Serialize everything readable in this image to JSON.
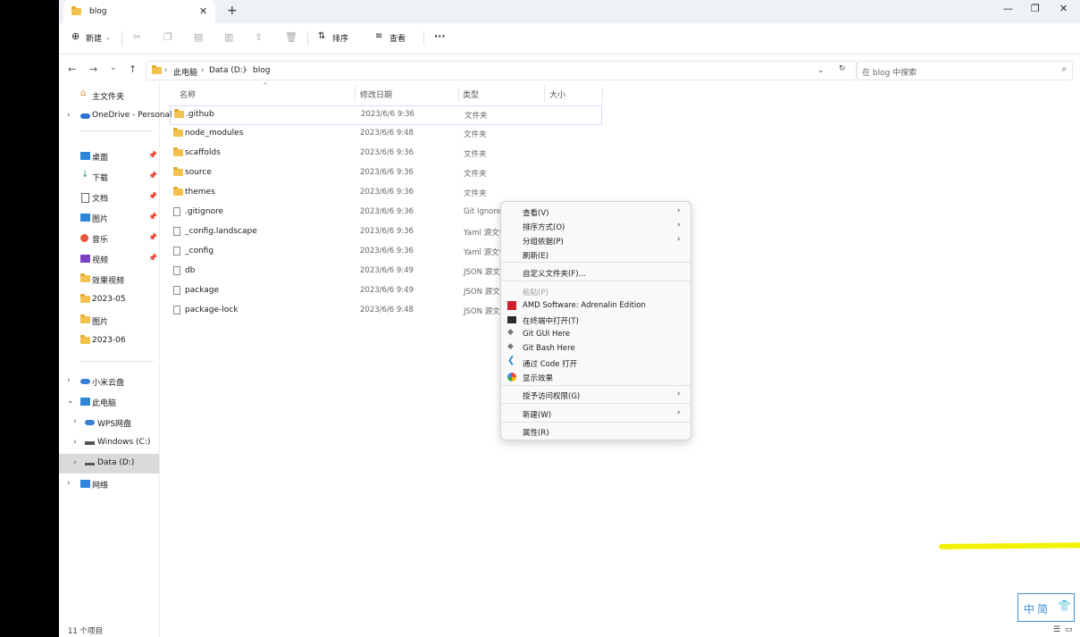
{
  "window": {
    "tab_title": "blog",
    "close_tab": "✕",
    "new_tab": "+",
    "minimize": "—",
    "maximize": "❐",
    "close": "✕"
  },
  "toolbar": {
    "new_label": "新建",
    "sort_label": "排序",
    "view_label": "查看",
    "more_label": "···"
  },
  "address": {
    "crumbs": [
      "此电脑",
      "Data (D:)",
      "blog"
    ],
    "search_placeholder": "在 blog 中搜索"
  },
  "sidebar": {
    "items": [
      {
        "label": "主文件夹"
      },
      {
        "label": "OneDrive - Personal"
      },
      {
        "label": "桌面"
      },
      {
        "label": "下载"
      },
      {
        "label": "文档"
      },
      {
        "label": "图片"
      },
      {
        "label": "音乐"
      },
      {
        "label": "视频"
      },
      {
        "label": "效果视频"
      },
      {
        "label": "2023-05"
      },
      {
        "label": "图片"
      },
      {
        "label": "2023-06"
      },
      {
        "label": "小米云盘"
      },
      {
        "label": "此电脑"
      },
      {
        "label": "WPS网盘"
      },
      {
        "label": "Windows (C:)"
      },
      {
        "label": "Data (D:)"
      },
      {
        "label": "网络"
      }
    ]
  },
  "columns": {
    "name": "名称",
    "date": "修改日期",
    "type": "类型",
    "size": "大小"
  },
  "files": [
    {
      "name": ".github",
      "date": "2023/6/6 9:36",
      "type": "文件夹",
      "kind": "folder"
    },
    {
      "name": "node_modules",
      "date": "2023/6/6 9:48",
      "type": "文件夹",
      "kind": "folder"
    },
    {
      "name": "scaffolds",
      "date": "2023/6/6 9:36",
      "type": "文件夹",
      "kind": "folder"
    },
    {
      "name": "source",
      "date": "2023/6/6 9:36",
      "type": "文件夹",
      "kind": "folder"
    },
    {
      "name": "themes",
      "date": "2023/6/6 9:36",
      "type": "文件夹",
      "kind": "folder"
    },
    {
      "name": ".gitignore",
      "date": "2023/6/6 9:36",
      "type": "Git Ignore",
      "kind": "doc"
    },
    {
      "name": "_config.landscape",
      "date": "2023/6/6 9:36",
      "type": "Yaml 源文件",
      "kind": "doc"
    },
    {
      "name": "_config",
      "date": "2023/6/6 9:36",
      "type": "Yaml 源文件",
      "kind": "doc"
    },
    {
      "name": "db",
      "date": "2023/6/6 9:49",
      "type": "JSON 源文",
      "kind": "doc"
    },
    {
      "name": "package",
      "date": "2023/6/6 9:49",
      "type": "JSON 源文",
      "kind": "doc"
    },
    {
      "name": "package-lock",
      "date": "2023/6/6 9:48",
      "type": "JSON 源文",
      "kind": "doc"
    }
  ],
  "context_menu": {
    "view": "查看(V)",
    "sort": "排序方式(O)",
    "group": "分组依据(P)",
    "refresh": "刷新(E)",
    "customize": "自定义文件夹(F)...",
    "paste": "粘贴(P)",
    "amd": "AMD Software: Adrenalin Edition",
    "terminal": "在终端中打开(T)",
    "git_gui": "Git GUI Here",
    "git_bash": "Git Bash Here",
    "vscode": "通过 Code 打开",
    "display": "显示效果",
    "access": "授予访问权限(G)",
    "new": "新建(W)",
    "properties": "属性(R)",
    "submenu_arrow": "›"
  },
  "status": {
    "item_count": "11 个项目"
  },
  "ime": {
    "text": "中简"
  },
  "colors": {
    "highlight": "#f2f200",
    "folder": "#f2c14e",
    "accent": "#3b8fd6"
  }
}
